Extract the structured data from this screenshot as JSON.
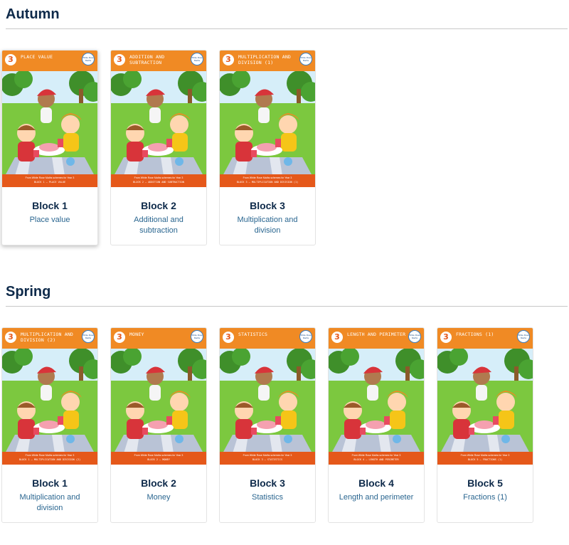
{
  "sections": [
    {
      "title": "Autumn",
      "cards": [
        {
          "cover_title": "PLACE VALUE",
          "cover_footer": "BLOCK 1 – PLACE VALUE",
          "block": "Block 1",
          "desc": "Place value"
        },
        {
          "cover_title": "ADDITION AND SUBTRACTION",
          "cover_footer": "BLOCK 2 – ADDITION AND SUBTRACTION",
          "block": "Block 2",
          "desc": "Additional and subtraction"
        },
        {
          "cover_title": "MULTIPLICATION AND DIVISION (1)",
          "cover_footer": "BLOCK 3 – MULTIPLICATION AND DIVISION (1)",
          "block": "Block 3",
          "desc": "Multiplication and division"
        }
      ]
    },
    {
      "title": "Spring",
      "cards": [
        {
          "cover_title": "MULTIPLICATION AND DIVISION (2)",
          "cover_footer": "BLOCK 1 – MULTIPLICATION AND DIVISION (2)",
          "block": "Block 1",
          "desc": "Multiplication and division"
        },
        {
          "cover_title": "MONEY",
          "cover_footer": "BLOCK 2 – MONEY",
          "block": "Block 2",
          "desc": "Money"
        },
        {
          "cover_title": "STATISTICS",
          "cover_footer": "BLOCK 3 – STATISTICS",
          "block": "Block 3",
          "desc": "Statistics"
        },
        {
          "cover_title": "LENGTH AND PERIMETER",
          "cover_footer": "BLOCK 4 – LENGTH AND PERIMETER",
          "block": "Block 4",
          "desc": "Length and perimeter"
        },
        {
          "cover_title": "FRACTIONS (1)",
          "cover_footer": "BLOCK 5 – FRACTIONS (1)",
          "block": "Block 5",
          "desc": "Fractions (1)"
        }
      ]
    }
  ],
  "cover": {
    "year_number": "3",
    "logo_text": "White Rose Maths",
    "footer_line1": "From White Rose Maths schemes for Year 3",
    "illustration": "children-picnic-illustration"
  },
  "colors": {
    "accent_orange": "#f08a24",
    "footer_orange": "#e5581a",
    "heading_navy": "#0e2a4a",
    "link_blue": "#2a6690"
  }
}
